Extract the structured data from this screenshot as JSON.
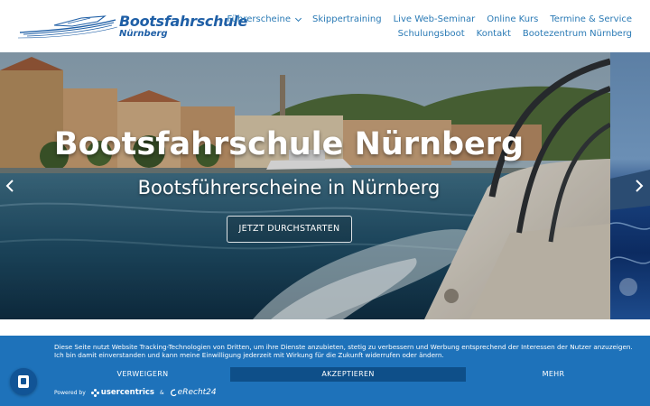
{
  "logo": {
    "title": "Bootsfahrschule",
    "subtitle": "Nürnberg"
  },
  "nav": {
    "row1": [
      "Führerscheine",
      "Skippertraining",
      "Live Web-Seminar",
      "Online Kurs",
      "Termine & Service"
    ],
    "row2": [
      "Schulungsboot",
      "Kontakt",
      "Bootezentrum Nürnberg"
    ]
  },
  "hero": {
    "title": "Bootsfahrschule Nürnberg",
    "subtitle": "Bootsführerscheine in Nürnberg",
    "cta": "JETZT DURCHSTARTEN"
  },
  "cookie": {
    "text": "Diese Seite nutzt Website Tracking-Technologien von Dritten, um ihre Dienste anzubieten, stetig zu verbessern und Werbung entsprechend der Interessen der Nutzer anzuzeigen. Ich bin damit einverstanden und kann meine Einwilligung jederzeit mit Wirkung für die Zukunft widerrufen oder ändern.",
    "decline": "VERWEIGERN",
    "accept": "AKZEPTIEREN",
    "more": "MEHR",
    "powered_by": "Powered by",
    "brand1": "usercentrics",
    "and": "&",
    "brand2": "eRecht24"
  },
  "colors": {
    "brand": "#1f5fa6",
    "nav": "#2a7ab5",
    "cookie_bg": "#1e72ba",
    "accept_bg": "#0e4f89"
  },
  "icons": {
    "nav_dropdown": "chevron-down-icon",
    "hero_prev": "chevron-left-icon",
    "hero_next": "chevron-right-icon",
    "privacy": "privacy-settings-icon"
  }
}
